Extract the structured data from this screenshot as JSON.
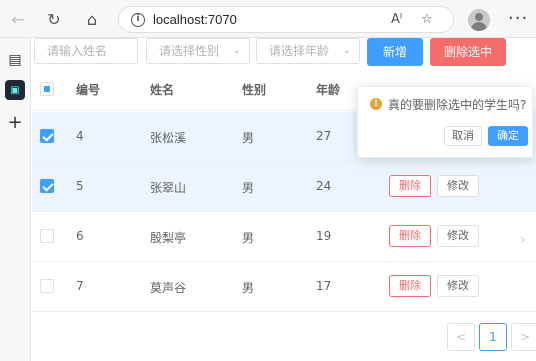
{
  "browser": {
    "url": "localhost:7070"
  },
  "toolbar": {
    "name_placeholder": "请输入姓名",
    "gender_placeholder": "请选择性别",
    "age_placeholder": "请选择年龄",
    "add_label": "新增",
    "delete_selected_label": "删除选中"
  },
  "table": {
    "columns": [
      "编号",
      "姓名",
      "性别",
      "年龄"
    ],
    "rows": [
      {
        "id": "4",
        "name": "张松溪",
        "gender": "男",
        "age": "27",
        "selected": true
      },
      {
        "id": "5",
        "name": "张翠山",
        "gender": "男",
        "age": "24",
        "selected": true
      },
      {
        "id": "6",
        "name": "殷梨亭",
        "gender": "男",
        "age": "19",
        "selected": false
      },
      {
        "id": "7",
        "name": "莫声谷",
        "gender": "男",
        "age": "17",
        "selected": false
      }
    ],
    "delete_label": "删除",
    "edit_label": "修改"
  },
  "popconfirm": {
    "title": "真的要删除选中的学生吗?",
    "cancel_label": "取消",
    "confirm_label": "确定"
  },
  "pagination": {
    "prev": "<",
    "current": "1",
    "next": ">"
  },
  "colors": {
    "primary": "#409eff",
    "danger": "#f56c6c",
    "warning": "#e6a23c",
    "selected_row": "#ecf5ff"
  }
}
